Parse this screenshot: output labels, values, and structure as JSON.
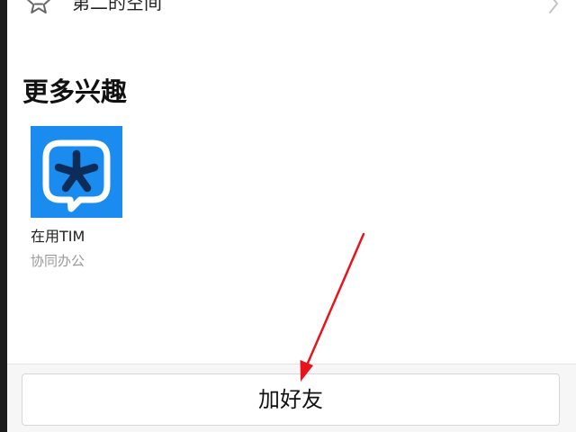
{
  "top_row": {
    "label": "第二的空间",
    "icon": "star-icon"
  },
  "interests": {
    "title": "更多兴趣",
    "items": [
      {
        "name": "在用TIM",
        "description": "协同办公",
        "icon": "tim-app-icon"
      }
    ]
  },
  "bottom_bar": {
    "add_friend_label": "加好友"
  },
  "colors": {
    "tim_blue": "#1a8cf0",
    "annotation_red": "#e8141c"
  }
}
